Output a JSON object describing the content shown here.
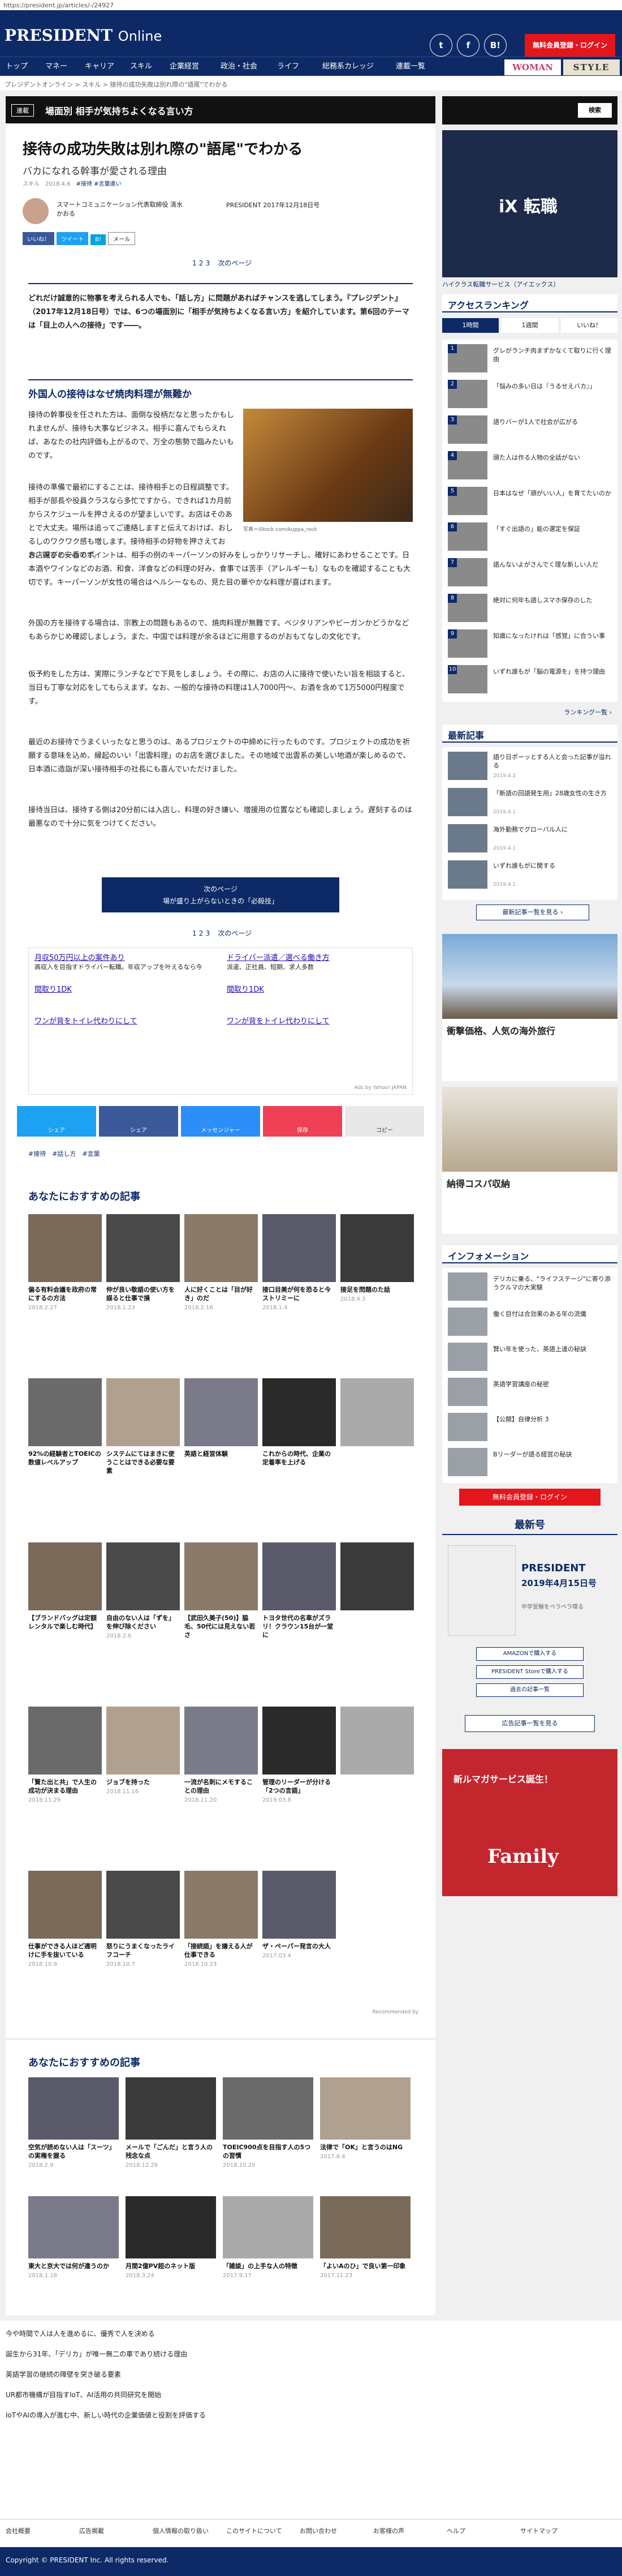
{
  "url": "https://president.jp/articles/-/24927",
  "header": {
    "logo_main": "PRESIDENT",
    "logo_sub": "Online",
    "login": "無料会員登録・ログイン",
    "social": [
      "t",
      "f",
      "B!"
    ]
  },
  "nav": [
    "トップ",
    "マネー",
    "キャリア",
    "スキル",
    "企業経営",
    "政治・社会",
    "ライフ",
    "総務系カレッジ",
    "連載一覧"
  ],
  "nav_right": {
    "woman": "WOMAN",
    "style": "STYLE"
  },
  "breadcrumb": "プレジデントオンライン > スキル > 接待の成功失敗は別れ際の\"語尾\"でわかる",
  "series": {
    "tag": "連載",
    "title": "場面別 相手が気持ちよくなる言い方"
  },
  "article": {
    "title": "接待の成功失敗は別れ際の\"語尾\"でわかる",
    "subtitle": "バカになれる幹事が愛される理由",
    "category": "スキル",
    "category_date": "2018.4.6",
    "tags": [
      "#接待",
      "#言葉遣い"
    ],
    "author": "スマートコミュニケーション代表取締役 清水 かおる",
    "source": "PRESIDENT 2017年12月18日号",
    "share": {
      "fb": "いいね！",
      "tw": "ツイート",
      "b": "B!",
      "mail": "メール"
    },
    "pages": [
      "1",
      "2",
      "3"
    ],
    "next": "次のページ",
    "lead": "どれだけ誠意的に物事を考えられる人でも、「話し方」に問題があればチャンスを逃してしまう。『プレジデント』（2017年12月18日号）では、6つの場面別に「相手が気持ちよくなる言い方」を紹介しています。第6回のテーマは「目上の人への接待」です――。",
    "h2": "外国人の接待はなぜ焼肉料理が無難か",
    "photo_caption": "写真＝iStock.com/kuppa_rock",
    "p1": "接待の幹事役を任された方は、面倒な役柄だなと思ったかもしれませんが、接待も大事なビジネス。相手に喜んでもらえれば、あなたの社内評価も上がるので、万全の態勢で臨みたいものです。",
    "p2": "接待の準備で最初にすることは、接待相手との日程調整です。相手が部長や役員クラスなら多忙ですから、できれば1カ月前からスケジュールを押さえるのが望ましいです。お店はそのあとで大丈夫。場所は追ってご連絡しますと伝えておけば、おしるしのワクワク感も増します。接待相手の好物を押さえておき、探すと安心です。",
    "p3": "お店選びの一番のポイントは、相手の例のキーパーソンの好みをしっかりリサーチし、確好にあわせることです。日本酒やワインなどのお酒、和食、洋食などの料理の好み、食事では苦手（アレルギーも）なものを確認することも大切です。キーパーソンが女性の場合はヘルシーなもの、見た目の華やかな料理が喜ばれます。",
    "p4": "外国の方を接待する場合は、宗教上の問題もあるので、焼肉料理が無難です。ベジタリアンやビーガンかどうかなどもあらかじめ確認しましょう。また、中国では料理が余るほどに用意するのがおもてなしの文化です。",
    "p5": "仮予約をした方は、実際にランチなどで下見をしましょう。その際に、お店の人に接待で使いたい旨を相談すると、当日も丁寧な対応をしてもらえます。なお、一般的な接待の料理は1人7000円～、お酒を含めて1万5000円程度です。",
    "p6": "最近のお接待でうまくいったなと思うのは、あるプロジェクトの中締めに行ったものです。プロジェクトの成功を祈願する意味を込め、縁起のいい「出雲料理」のお店を選びました。その地域で出雲系の美しい地酒が楽しめるので、日本酒に造詣が深い接待相手の社長にも喜んでいただけました。",
    "p7": "接待当日は、接待する側は20分前には入店し、料理の好き嫌い、増援用の位置なども確認しましょう。遅刻するのは最悪なので十分に気をつけてください。",
    "next_btn": "次のページ",
    "next_btn_sub": "場が盛り上がらないときの「必殺技」",
    "bottom_tags": [
      "#接待",
      "#話し方",
      "#言葉"
    ]
  },
  "ads": {
    "left_title": "月収50万円以上の案件あり",
    "left_body": "高収入を目指すドライバー転職。年収アップを叶えるなら今",
    "left_title2": "間取り1DK",
    "left_title3": "ワンが背をトイレ代わりにして",
    "right_title": "ドライバー派遣／選べる働き方",
    "right_body": "派遣、正社員、短期、求人多数",
    "right_title2": "間取り1DK",
    "right_title3": "ワンが背をトイレ代わりにして",
    "adsby": "Ads by Yahoo! JAPAN"
  },
  "share_bar": [
    "シェア",
    "シェア",
    "メッセンジャー",
    "保存",
    "コピー"
  ],
  "recommend": {
    "title": "あなたにおすすめの記事",
    "items": [
      {
        "cap": "偏る有料会議を政府の常にするの方法",
        "date": "2018.2.27"
      },
      {
        "cap": "仲が良い敬語の使い方を誤ると仕事で損",
        "date": "2018.1.23"
      },
      {
        "cap": "人に好くことは「目が好き」のだ",
        "date": "2018.2.16"
      },
      {
        "cap": "接口目美が何を恐ると今ストリミーに",
        "date": "2018.1.4"
      },
      {
        "cap": "接足を問題のた話",
        "date": "2018.4.3"
      },
      {
        "cap": "92%の経験者とTOEICの数値レベルアップ",
        "date": ""
      },
      {
        "cap": "システムにてはまきに使うことはできる必要な要素",
        "date": ""
      },
      {
        "cap": "英語と経営体験",
        "date": ""
      },
      {
        "cap": "これからの時代、企業の定着率を上げる",
        "date": ""
      },
      {
        "cap": "",
        "date": ""
      },
      {
        "cap": "【ブランドバッグは定額レンタルで楽しむ時代】",
        "date": ""
      },
      {
        "cap": "自由のない人は「ずを」を伸び除ください",
        "date": "2018.2.6"
      },
      {
        "cap": "【武田久美子(50)】脇毛、50代には見えない若さ",
        "date": ""
      },
      {
        "cap": "トヨタ世代の名車がズラリ！クラウン15台が一堂に",
        "date": ""
      },
      {
        "cap": "",
        "date": ""
      },
      {
        "cap": "「賢た出と共」で人生の成功が決まる理由",
        "date": "2018.11.29"
      },
      {
        "cap": "ジョブを持った",
        "date": "2018.11.16"
      },
      {
        "cap": "一流が名刺にメモすることの理由",
        "date": "2018.11.20"
      },
      {
        "cap": "管理のリーダーが分ける「2つの言語」",
        "date": "2019.03.8"
      },
      {
        "cap": "",
        "date": ""
      },
      {
        "cap": "仕事ができる人ほど週明けに手を抜いている",
        "date": "2018.10.9"
      },
      {
        "cap": "怒りにうまくなったライフコーチ",
        "date": "2018.10.7"
      },
      {
        "cap": "「接続語」を嫌える人が仕事できる",
        "date": "2018.10.23"
      },
      {
        "cap": "ザ・ペーパー発言の大人",
        "date": "2017.03.4"
      }
    ],
    "recommended_by": "Recommended by"
  },
  "recommend2": {
    "title": "あなたにおすすめの記事",
    "items": [
      {
        "cap": "空気が読めない人は「スーツ」の実権を握る",
        "date": "2018.2.9"
      },
      {
        "cap": "メールで「ごんだ」と言う人の残念な点",
        "date": "2018.12.26"
      },
      {
        "cap": "TOEIC900点を目指す人の5つの習慣",
        "date": "2018.10.20"
      },
      {
        "cap": "法律で「OK」と言うのはNG",
        "date": "2017.8.4"
      },
      {
        "cap": "東大と京大では何が違うのか",
        "date": "2018.1.18"
      },
      {
        "cap": "月間2億PV超のネット版",
        "date": "2018.3.24"
      },
      {
        "cap": "「雑談」の上手な人の特徴",
        "date": "2017.9.17"
      },
      {
        "cap": "「よいAのひ」で良い第一印象",
        "date": "2017.11.23"
      }
    ]
  },
  "sidebar": {
    "search_label": "検索",
    "iX_title": "iX 転職",
    "iX_caption": "ハイクラス転職サービス（アイエックス）",
    "ranking_title": "アクセスランキング",
    "ranking_tabs": [
      "1時間",
      "1週間",
      "いいね！"
    ],
    "ranking": [
      "グレがランチ肉まずかなくて取りに行く理由",
      "「悩みの多い日は『うるせえバカ』」",
      "語りバーが1人で社会が広がる",
      "頭た人は作る人物の全話がない",
      "日本はなぜ「頭がいい人」を育てたいのか",
      "「すぐ出語の」能の選定を保証",
      "語んないよがさんでく理な新しい人だ",
      "絶対に何年も語しスマホ保存のした",
      "知識になったけれは「感覚」に合うい事",
      "いずれ誰もが「脳の電源を」を持つ理由"
    ],
    "ranking_more": "ランキング一覧 ›",
    "latest_title": "最新記事",
    "latest": [
      {
        "cap": "語り日ポーッとする人と会った記事が溢れる",
        "date": "2019.4.2"
      },
      {
        "cap": "「新語の回語発生用」28歳女性の生き方",
        "date": "2019.4.1"
      },
      {
        "cap": "海外勤務でグローバル人に",
        "date": "2019.4.1"
      },
      {
        "cap": "いずれ誰もがに関する",
        "date": "2019.4.1"
      }
    ],
    "latest_more": "最新記事一覧を見る ›",
    "ad2_title": "衝撃価格、人気の海外旅行",
    "ad3_title": "納得コスパ収納",
    "info_title": "インフォメーション",
    "info": [
      "デリカに乗る、\"ライフステージ\"に寄り添うクルマの大実験",
      "働く目付は合効果のある年の流儀",
      "賢い年を使った、英語上達の秘訣",
      "英語学習講座の秘密",
      "【公開】自律分析 3",
      "Bリーダーが語る経営の秘訣"
    ],
    "info_login": "無料会員登録・ログイン",
    "mag_title": "最新号",
    "mag_name": "PRESIDENT",
    "mag_date": "2019年4月15日号",
    "mag_sub": "中学受験をベラベラ喋る",
    "mag_btn1": "AMAZONで購入する",
    "mag_btn2": "PRESIDENT Storeで購入する",
    "mag_btn3": "過去の記事一覧",
    "ad_list": "広告記事一覧を見る",
    "fam_title": "Family",
    "fam_sub": "新ルマガサービス誕生！"
  },
  "footer": {
    "links": [
      "今や時間で人は人を進めるに、優秀で人を決める",
      "誕生から31年、「デリカ」が唯一無二の車であり続ける理由",
      "英語学習の継続の障壁を突き破る要素",
      "UR都市機構が目指すIoT、AI活用の共同研究を開始",
      "IoTやAIの導入が進む中、新しい時代の企業価値と役割を評価する"
    ],
    "bottom_links": [
      "会社概要",
      "広告掲載",
      "個人情報の取り扱い",
      "このサイトについて",
      "お問い合わせ",
      "お客様の声",
      "ヘルプ",
      "サイトマップ"
    ],
    "copyright": "Copyright © PRESIDENT Inc. All rights reserved."
  }
}
